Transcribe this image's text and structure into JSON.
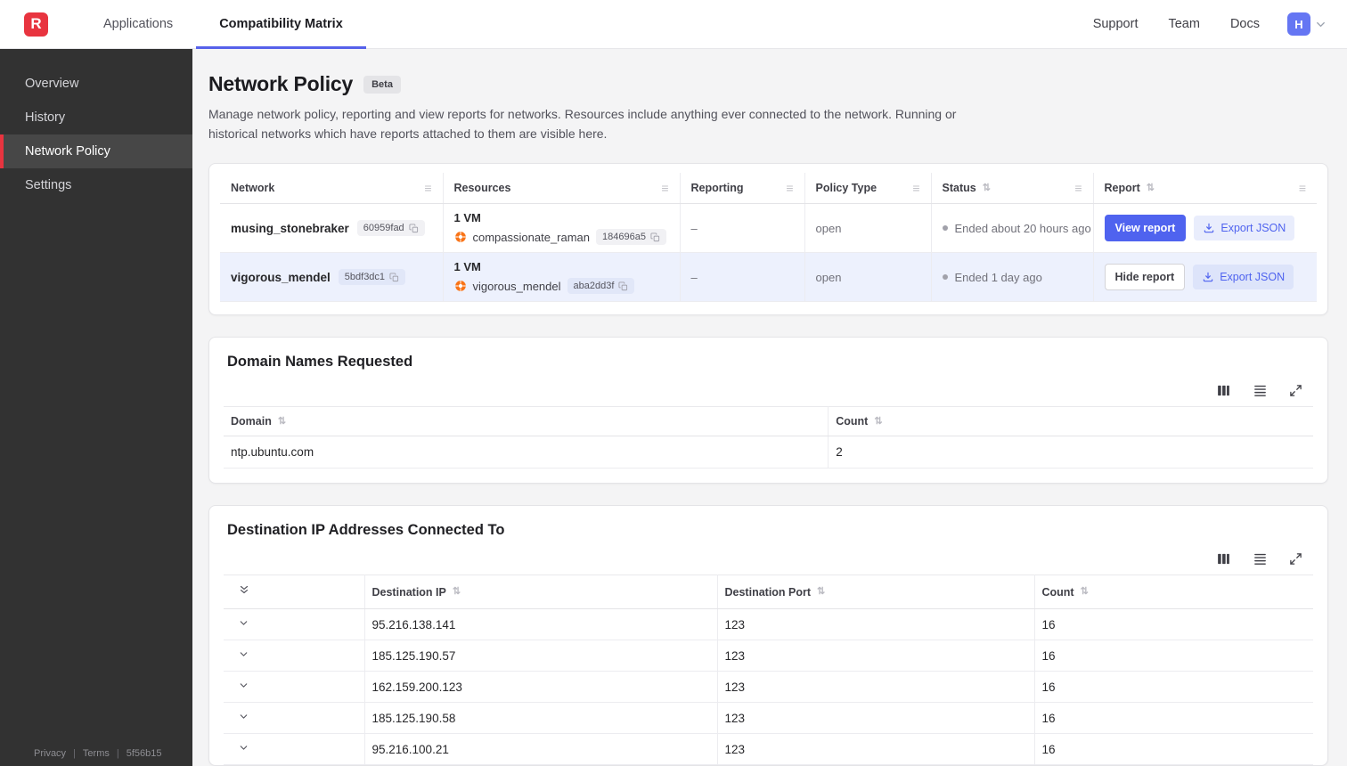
{
  "colors": {
    "accent": "#4f63ef",
    "logo_red": "#e8343f",
    "nav_underline": "#5661ea",
    "sidebar_bg": "#323232",
    "sidebar_active_bar": "#e8343f",
    "row_highlight": "#edf1fd",
    "resource_icon_orange": "#f97316",
    "status_dot_gray": "#a1a1aa"
  },
  "ui": {
    "sort_icon": "⇅",
    "drag_icon": "≡",
    "divider": "|"
  },
  "topbar": {
    "logo_letter": "R",
    "nav": [
      {
        "label": "Applications",
        "active": false
      },
      {
        "label": "Compatibility Matrix",
        "active": true
      }
    ],
    "links": [
      {
        "label": "Support"
      },
      {
        "label": "Team"
      },
      {
        "label": "Docs"
      }
    ],
    "avatar_letter": "H"
  },
  "sidebar": {
    "items": [
      {
        "label": "Overview",
        "active": false
      },
      {
        "label": "History",
        "active": false
      },
      {
        "label": "Network Policy",
        "active": true
      },
      {
        "label": "Settings",
        "active": false
      }
    ],
    "footer": {
      "privacy": "Privacy",
      "terms": "Terms",
      "version": "5f56b15"
    }
  },
  "page": {
    "title": "Network Policy",
    "badge": "Beta",
    "description": "Manage network policy, reporting and view reports for networks. Resources include anything ever connected to the network. Running or historical networks which have reports attached to them are visible here."
  },
  "networks_table": {
    "columns": {
      "network": "Network",
      "resources": "Resources",
      "reporting": "Reporting",
      "policy_type": "Policy Type",
      "status": "Status",
      "report": "Report"
    },
    "rows": [
      {
        "name": "musing_stonebraker",
        "id": "60959fad",
        "vm_count": "1 VM",
        "resource_name": "compassionate_raman",
        "resource_id": "184696a5",
        "reporting": "–",
        "policy_type": "open",
        "status": "Ended about 20 hours ago",
        "report_label": "View report",
        "export_label": "Export JSON",
        "report_primary": true,
        "highlighted": false
      },
      {
        "name": "vigorous_mendel",
        "id": "5bdf3dc1",
        "vm_count": "1 VM",
        "resource_name": "vigorous_mendel",
        "resource_id": "aba2dd3f",
        "reporting": "–",
        "policy_type": "open",
        "status": "Ended 1 day ago",
        "report_label": "Hide report",
        "export_label": "Export JSON",
        "report_primary": false,
        "highlighted": true
      }
    ]
  },
  "domains_table": {
    "title": "Domain Names Requested",
    "columns": {
      "domain": "Domain",
      "count": "Count"
    },
    "rows": [
      {
        "domain": "ntp.ubuntu.com",
        "count": "2"
      }
    ]
  },
  "destinations_table": {
    "title": "Destination IP Addresses Connected To",
    "columns": {
      "ip": "Destination IP",
      "port": "Destination Port",
      "count": "Count"
    },
    "rows": [
      {
        "ip": "95.216.138.141",
        "port": "123",
        "count": "16"
      },
      {
        "ip": "185.125.190.57",
        "port": "123",
        "count": "16"
      },
      {
        "ip": "162.159.200.123",
        "port": "123",
        "count": "16"
      },
      {
        "ip": "185.125.190.58",
        "port": "123",
        "count": "16"
      },
      {
        "ip": "95.216.100.21",
        "port": "123",
        "count": "16"
      }
    ]
  }
}
